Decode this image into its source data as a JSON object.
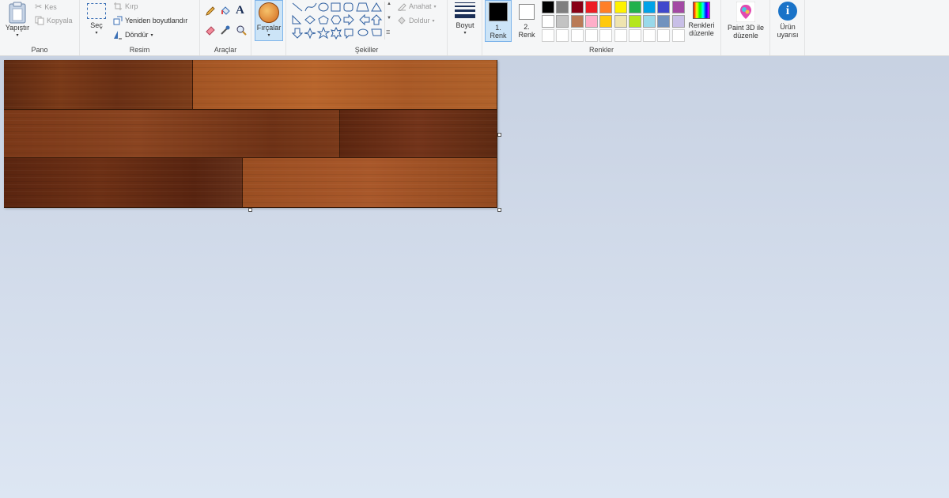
{
  "ribbon": {
    "pano": {
      "label": "Pano",
      "paste": "Yapıştır",
      "cut": "Kes",
      "copy": "Kopyala"
    },
    "resim": {
      "label": "Resim",
      "select": "Seç",
      "crop": "Kırp",
      "resize": "Yeniden boyutlandır",
      "rotate": "Döndür"
    },
    "araclar": {
      "label": "Araçlar"
    },
    "brushes": {
      "label": "Fırçalar"
    },
    "sekiller": {
      "label": "Şekiller",
      "outline": "Anahat",
      "fill": "Doldur"
    },
    "size": {
      "label": "Boyut"
    },
    "renkler": {
      "label": "Renkler",
      "color1_line1": "1.",
      "color1_line2": "Renk",
      "color2_line1": "2.",
      "color2_line2": "Renk",
      "edit_line1": "Renkleri",
      "edit_line2": "düzenle",
      "palette_row1": [
        "#000000",
        "#7f7f7f",
        "#880015",
        "#ed1c24",
        "#ff7f27",
        "#fff200",
        "#22b14c",
        "#00a2e8",
        "#3f48cc",
        "#a349a4"
      ],
      "palette_row2": [
        "#ffffff",
        "#c3c3c3",
        "#b97a57",
        "#ffaec9",
        "#ffc90e",
        "#efe4b0",
        "#b5e61d",
        "#99d9ea",
        "#7092be",
        "#c8bfe7"
      ]
    },
    "paint3d": {
      "line1": "Paint 3D ile",
      "line2": "düzenle"
    },
    "product": {
      "line1": "Ürün",
      "line2": "uyarısı"
    }
  }
}
